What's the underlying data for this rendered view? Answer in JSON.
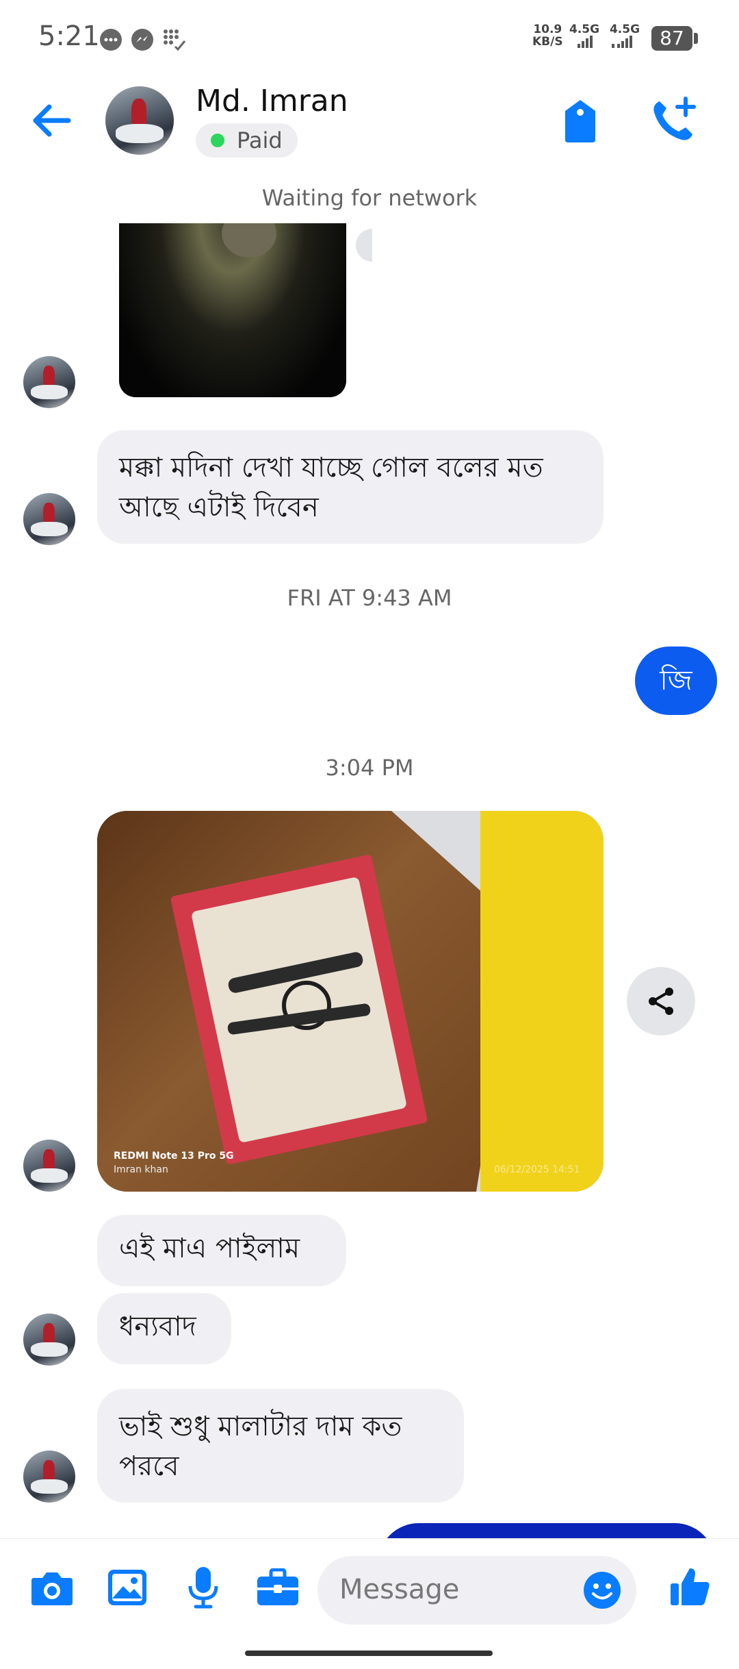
{
  "status_bar": {
    "time": "5:21",
    "net_speed_top": "10.9",
    "net_speed_bottom": "KB/S",
    "sig1": "4.5G",
    "sig2": "4.5G",
    "battery": "87"
  },
  "header": {
    "name": "Md. Imran",
    "badge": "Paid"
  },
  "thread": {
    "network_status": "Waiting for network",
    "msg1": "মক্কা মদিনা দেখা যাচ্ছে গোল বলের মত আছে এটাই দিবেন",
    "ts1": "FRI AT 9:43 AM",
    "sent1": "জি",
    "ts2": "3:04 PM",
    "photo_caption_model": "REDMI Note 13 Pro 5G",
    "photo_caption_name": "Imran khan",
    "photo_caption_date": "06/12/2025 14:51",
    "msg2": "এই মাএ পাইলাম",
    "msg3": "ধন্যবাদ",
    "msg4": "ভাই শুধু মালাটার দাম কত পরবে"
  },
  "composer": {
    "placeholder": "Message"
  },
  "colors": {
    "accent": "#0a7cff",
    "sent_bubble": "#0d5cf0",
    "incoming_bubble": "#f0f0f4",
    "online": "#2bd65d"
  },
  "icons": [
    "back-arrow-icon",
    "tag-icon",
    "add-call-icon",
    "share-icon",
    "camera-icon",
    "gallery-icon",
    "microphone-icon",
    "briefcase-icon",
    "emoji-icon",
    "like-icon"
  ]
}
